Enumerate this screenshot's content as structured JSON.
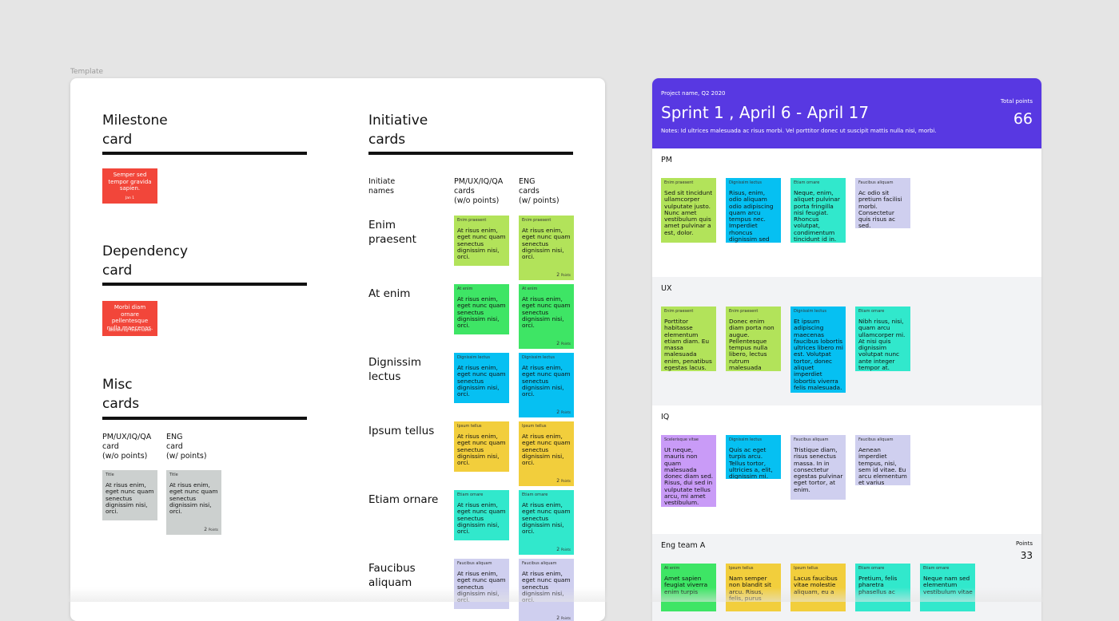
{
  "colors": {
    "background": "#e5e5e5",
    "board_header": "#5838e2",
    "lane_alt": "#f2f3f5",
    "red": "#f2463a",
    "lime": "#b2e35a",
    "green": "#3ee565",
    "blue": "#06c0f2",
    "yellow": "#f2ce3c",
    "teal": "#31e8cc",
    "lavender": "#cfcfef",
    "purple": "#c99bf7",
    "gray": "#ccd0cf"
  },
  "template": {
    "frame_label": "Template",
    "milestone": {
      "title": "Milestone\ncard",
      "card_text": "Semper sed tempor gravida sapien.",
      "card_sub": "Jan 1"
    },
    "dependency": {
      "title": "Dependency\ncard",
      "card_text": "Morbi diam ornare pellentesque nulla maecenas.",
      "card_sub": "Blocked by: team name"
    },
    "misc": {
      "title": "Misc\ncards",
      "col1_label": "PM/UX/IQ/QA\ncard\n(w/o points)",
      "col2_label": "ENG\ncard\n(w/ points)",
      "card_tag": "Title",
      "card_text": "At risus enim, eget nunc quam senectus dignissim nisi, orci.",
      "card_points": "2",
      "points_word": "Points"
    },
    "initiative": {
      "title": "Initiative\ncards",
      "col0_label": "Initiate\nnames",
      "col1_label": "PM/UX/IQ/QA\ncards\n(w/o points)",
      "col2_label": "ENG\ncards\n(w/ points)",
      "card_text": "At risus enim, eget nunc quam senectus dignissim nisi, orci.",
      "card_points": "2",
      "points_word": "Points",
      "rows": [
        {
          "name": "Enim\npraesent",
          "tag": "Enim praesent",
          "color": "#b2e35a"
        },
        {
          "name": "At enim",
          "tag": "At enim",
          "color": "#3ee565"
        },
        {
          "name": "Dignissim\nlectus",
          "tag": "Dignissim lectus",
          "color": "#06c0f2"
        },
        {
          "name": "Ipsum tellus",
          "tag": "Ipsum tellus",
          "color": "#f2ce3c"
        },
        {
          "name": "Etiam ornare",
          "tag": "Etiam ornare",
          "color": "#31e8cc"
        },
        {
          "name": "Faucibus\naliquam",
          "tag": "Faucibus aliquam",
          "color": "#cfcfef"
        }
      ]
    }
  },
  "board": {
    "project": "Project name, Q2 2020",
    "sprint_title": "Sprint 1 , April 6 - April 17",
    "notes": "Notes: Id ultrices malesuada ac risus morbi. Vel porttitor donec ut suscipit mattis nulla nisi, morbi.",
    "total_points_label": "Total points",
    "total_points": "66",
    "lanes": [
      {
        "name": "PM",
        "cards": [
          {
            "tag": "Enim praesent",
            "text": "Sed sit tincidunt ullamcorper vulputate justo. Nunc amet vestibulum quis amet pulvinar a est, dolor.",
            "color": "#b2e35a"
          },
          {
            "tag": "Dignissim lectus",
            "text": "Risus, enim, odio aliquam odio adipiscing quam arcu tempus nec. Imperdiet rhoncus dignissim sed sem purus tellus.",
            "color": "#06c0f2"
          },
          {
            "tag": "Etiam ornare",
            "text": "Neque, enim, aliquet pulvinar porta fringilla nisi feugiat. Rhoncus volutpat, condimentum tincidunt id in.",
            "color": "#31e8cc"
          },
          {
            "tag": "Faucibus aliquam",
            "text": "Ac odio sit pretium facilisi morbi. Consectetur quis risus ac sed.",
            "color": "#cfcfef"
          }
        ]
      },
      {
        "name": "UX",
        "cards": [
          {
            "tag": "Enim praesent",
            "text": "Porttitor habitasse elementum etiam diam. Eu massa malesuada enim, penatibus egestas lacus.",
            "color": "#b2e35a"
          },
          {
            "tag": "Enim praesent",
            "text": "Donec enim diam porta non augue. Pellentesque tempus nulla libero, lectus rutrum malesuada risus.",
            "color": "#b2e35a"
          },
          {
            "tag": "Dignissim lectus",
            "text": "Et ipsum adipiscing maecenas faucibus lobortis ultrices libero mi est. Volutpat tortor, donec aliquet imperdiet lobortis viverra felis malesuada.",
            "color": "#06c0f2"
          },
          {
            "tag": "Etiam ornare",
            "text": "Nibh risus, nisi, quam arcu ullamcorper mi. At nisi quis dignissim volutpat nunc ante integer tempor at.",
            "color": "#31e8cc"
          }
        ]
      },
      {
        "name": "IQ",
        "cards": [
          {
            "tag": "Scelerisque vitae",
            "text": "Ut neque, mauris non quam malesuada donec diam sed. Risus, dui sed in vulputate tellus arcu, mi amet vestibulum.",
            "color": "#c99bf7"
          },
          {
            "tag": "Dignissim lectus",
            "text": "Quis ac eget turpis arcu. Tellus tortor, ultricies a, elit, dignissim mi.",
            "color": "#06c0f2"
          },
          {
            "tag": "Faucibus aliquam",
            "text": "Tristique diam, risus senectus massa. In in consectetur egestas pulvinar eget tortor, at enim.",
            "color": "#cfcfef"
          },
          {
            "tag": "Faucibus aliquam",
            "text": "Aenean imperdiet tempus, nisi, sem id vitae. Eu arcu elementum et varius dictum.",
            "color": "#cfcfef"
          }
        ]
      },
      {
        "name": "Eng team A",
        "points_label": "Points",
        "points": "33",
        "cards": [
          {
            "tag": "At enim",
            "text": "Amet sapien feugiat viverra enim turpis",
            "color": "#3ee565"
          },
          {
            "tag": "Ipsum tellus",
            "text": "Nam semper non blandit sit arcu. Risus, felis, purus",
            "color": "#f2ce3c"
          },
          {
            "tag": "Ipsum tellus",
            "text": "Lacus faucibus vitae molestie aliquam, eu a",
            "color": "#f2ce3c"
          },
          {
            "tag": "Etiam ornare",
            "text": "Pretium, felis pharetra phasellus ac",
            "color": "#31e8cc"
          },
          {
            "tag": "Etiam ornare",
            "text": "Neque nam sed elementum vestibulum vitae",
            "color": "#31e8cc"
          }
        ]
      }
    ]
  }
}
